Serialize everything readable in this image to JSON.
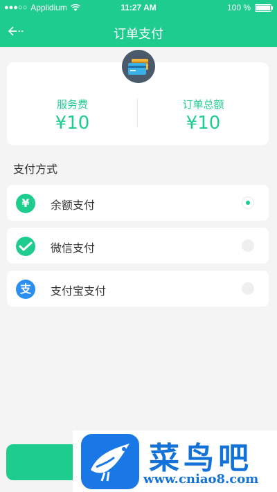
{
  "status_bar": {
    "carrier": "Applidium",
    "time": "11:27 AM",
    "battery": "100 %"
  },
  "header": {
    "title": "订单支付",
    "back_icon": "back-arrow-icon"
  },
  "summary": {
    "service_fee_label": "服务费",
    "service_fee_value": "¥10",
    "order_total_label": "订单总额",
    "order_total_value": "¥10",
    "icon": "credit-card-icon"
  },
  "payment": {
    "section_label": "支付方式",
    "methods": [
      {
        "label": "余额支付",
        "icon": "yen-icon",
        "icon_glyph": "¥",
        "color": "#1ecd8e",
        "selected": true
      },
      {
        "label": "微信支付",
        "icon": "wechat-icon",
        "color": "#1ecd8e",
        "selected": false
      },
      {
        "label": "支付宝支付",
        "icon": "alipay-icon",
        "icon_glyph": "支",
        "color": "#2a8ff0",
        "selected": false
      }
    ]
  },
  "watermark": {
    "title": "菜鸟吧",
    "url": "www.cniao8.com"
  },
  "colors": {
    "accent": "#1ecd8e",
    "alipay": "#2a8ff0",
    "watermark": "#1272d8"
  }
}
